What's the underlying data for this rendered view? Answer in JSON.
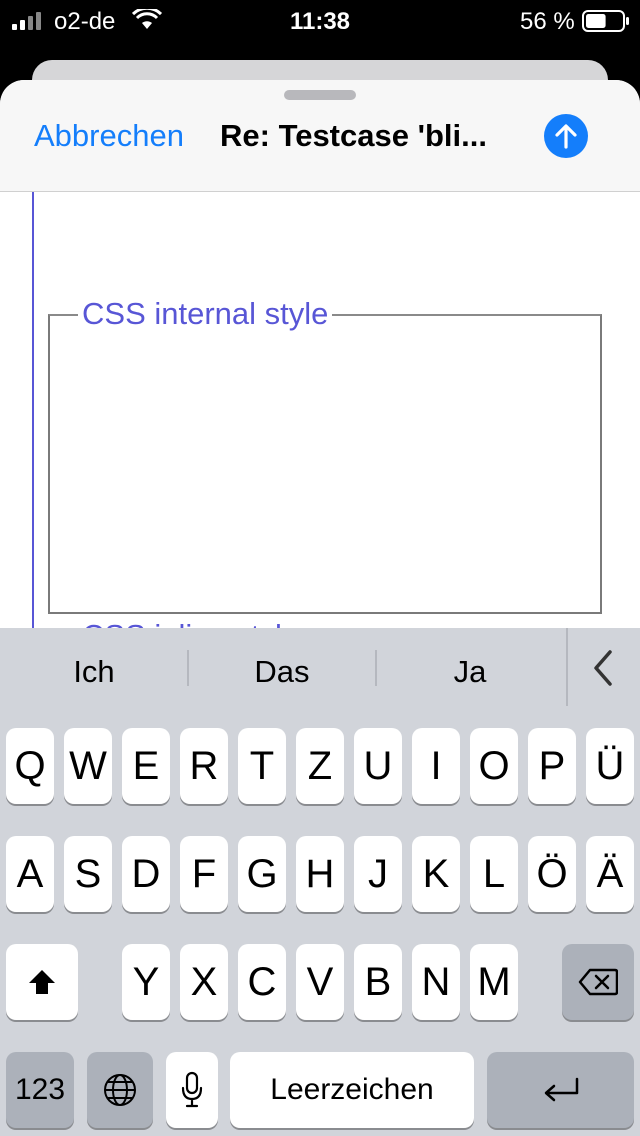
{
  "status": {
    "carrier": "o2-de",
    "time": "11:38",
    "battery_pct": "56 %",
    "battery_level": 0.56
  },
  "compose": {
    "cancel_label": "Abbrechen",
    "subject": "Re: Testcase 'bli..."
  },
  "body": {
    "legend": "CSS internal style",
    "cut_text": "CSS inline style"
  },
  "keyboard": {
    "suggestions": [
      "Ich",
      "Das",
      "Ja"
    ],
    "row1": [
      "Q",
      "W",
      "E",
      "R",
      "T",
      "Z",
      "U",
      "I",
      "O",
      "P",
      "Ü"
    ],
    "row2": [
      "A",
      "S",
      "D",
      "F",
      "G",
      "H",
      "J",
      "K",
      "L",
      "Ö",
      "Ä"
    ],
    "row3": [
      "Y",
      "X",
      "C",
      "V",
      "B",
      "N",
      "M"
    ],
    "numbers_label": "123",
    "space_label": "Leerzeichen"
  },
  "colors": {
    "accent": "#147efb",
    "quote": "#5856d6",
    "keyboard_bg": "#d1d4da"
  },
  "icons": [
    "signal-icon",
    "wifi-icon",
    "battery-icon",
    "send-arrow-icon",
    "chevron-left-icon",
    "shift-icon",
    "backspace-icon",
    "globe-icon",
    "microphone-icon",
    "return-icon"
  ]
}
